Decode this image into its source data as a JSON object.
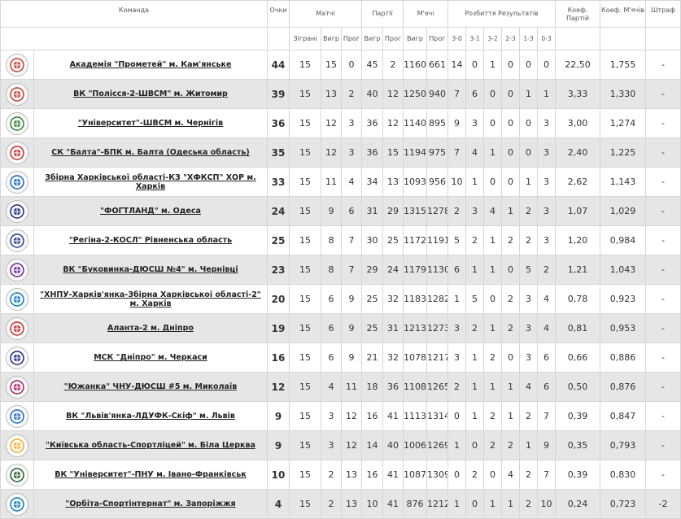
{
  "header": {
    "team": "Команда",
    "points": "Очки",
    "matches": "Матчі",
    "matches_sub": [
      "Зіграні",
      "Вигр",
      "Прог"
    ],
    "sets": "Партії",
    "sets_sub": [
      "Вигр",
      "Прог"
    ],
    "balls": "М'ячі",
    "balls_sub": [
      "Вигр",
      "Прог"
    ],
    "results": "Розбиття Результатів",
    "results_sub": [
      "3-0",
      "3-1",
      "3-2",
      "2-3",
      "1-3",
      "0-3"
    ],
    "coef_sets": "Коеф. Партій",
    "coef_balls": "Коеф. М'ячів",
    "penalty": "Штраф"
  },
  "rows": [
    {
      "team": "Академія \"Прометей\" м. Кам'янське",
      "logo": "team-logo-icon",
      "points": "44",
      "played": "15",
      "won": "15",
      "lost": "0",
      "sets_won": "45",
      "sets_lost": "2",
      "balls_won": "1160",
      "balls_lost": "661",
      "r30": "14",
      "r31": "0",
      "r32": "1",
      "r23": "0",
      "r13": "0",
      "r03": "0",
      "coef_sets": "22,50",
      "coef_balls": "1,755",
      "penalty": "-"
    },
    {
      "team": "ВК \"Полісся-2-ШВСМ\" м. Житомир",
      "logo": "team-logo-icon",
      "points": "39",
      "played": "15",
      "won": "13",
      "lost": "2",
      "sets_won": "40",
      "sets_lost": "12",
      "balls_won": "1250",
      "balls_lost": "940",
      "r30": "7",
      "r31": "6",
      "r32": "0",
      "r23": "0",
      "r13": "1",
      "r03": "1",
      "coef_sets": "3,33",
      "coef_balls": "1,330",
      "penalty": "-"
    },
    {
      "team": "\"Університет\"-ШВСМ м. Чернігів",
      "logo": "team-logo-icon",
      "points": "36",
      "played": "15",
      "won": "12",
      "lost": "3",
      "sets_won": "36",
      "sets_lost": "12",
      "balls_won": "1140",
      "balls_lost": "895",
      "r30": "9",
      "r31": "3",
      "r32": "0",
      "r23": "0",
      "r13": "0",
      "r03": "3",
      "coef_sets": "3,00",
      "coef_balls": "1,274",
      "penalty": "-"
    },
    {
      "team": "СК \"Балта\"-БПК м. Балта (Одеська область)",
      "logo": "team-logo-icon",
      "points": "35",
      "played": "15",
      "won": "12",
      "lost": "3",
      "sets_won": "36",
      "sets_lost": "15",
      "balls_won": "1194",
      "balls_lost": "975",
      "r30": "7",
      "r31": "4",
      "r32": "1",
      "r23": "0",
      "r13": "0",
      "r03": "3",
      "coef_sets": "2,40",
      "coef_balls": "1,225",
      "penalty": "-"
    },
    {
      "team": "Збірна Харківської області-КЗ \"ХФКСП\" ХОР м. Харків",
      "logo": "team-logo-icon",
      "points": "33",
      "played": "15",
      "won": "11",
      "lost": "4",
      "sets_won": "34",
      "sets_lost": "13",
      "balls_won": "1093",
      "balls_lost": "956",
      "r30": "10",
      "r31": "1",
      "r32": "0",
      "r23": "0",
      "r13": "1",
      "r03": "3",
      "coef_sets": "2,62",
      "coef_balls": "1,143",
      "penalty": "-"
    },
    {
      "team": "\"ФОГТЛАНД\" м. Одеса",
      "logo": "team-logo-icon",
      "points": "24",
      "played": "15",
      "won": "9",
      "lost": "6",
      "sets_won": "31",
      "sets_lost": "29",
      "balls_won": "1315",
      "balls_lost": "1278",
      "r30": "2",
      "r31": "3",
      "r32": "4",
      "r23": "1",
      "r13": "2",
      "r03": "3",
      "coef_sets": "1,07",
      "coef_balls": "1,029",
      "penalty": "-"
    },
    {
      "team": "\"Регіна-2-КОСЛ\" Рівненська область",
      "logo": "team-logo-icon",
      "points": "25",
      "played": "15",
      "won": "8",
      "lost": "7",
      "sets_won": "30",
      "sets_lost": "25",
      "balls_won": "1172",
      "balls_lost": "1191",
      "r30": "5",
      "r31": "2",
      "r32": "1",
      "r23": "2",
      "r13": "2",
      "r03": "3",
      "coef_sets": "1,20",
      "coef_balls": "0,984",
      "penalty": "-"
    },
    {
      "team": "ВК \"Буковинка-ДЮСШ №4\" м. Чернівці",
      "logo": "team-logo-icon",
      "points": "23",
      "played": "15",
      "won": "8",
      "lost": "7",
      "sets_won": "29",
      "sets_lost": "24",
      "balls_won": "1179",
      "balls_lost": "1130",
      "r30": "6",
      "r31": "1",
      "r32": "1",
      "r23": "0",
      "r13": "5",
      "r03": "2",
      "coef_sets": "1,21",
      "coef_balls": "1,043",
      "penalty": "-"
    },
    {
      "team": "\"ХНПУ-Харків'янка-Збірна Харківської області-2\" м. Харків",
      "logo": "team-logo-icon",
      "points": "20",
      "played": "15",
      "won": "6",
      "lost": "9",
      "sets_won": "25",
      "sets_lost": "32",
      "balls_won": "1183",
      "balls_lost": "1282",
      "r30": "1",
      "r31": "5",
      "r32": "0",
      "r23": "2",
      "r13": "3",
      "r03": "4",
      "coef_sets": "0,78",
      "coef_balls": "0,923",
      "penalty": "-"
    },
    {
      "team": "Аланта-2 м. Дніпро",
      "logo": "team-logo-icon",
      "points": "19",
      "played": "15",
      "won": "6",
      "lost": "9",
      "sets_won": "25",
      "sets_lost": "31",
      "balls_won": "1213",
      "balls_lost": "1273",
      "r30": "3",
      "r31": "2",
      "r32": "1",
      "r23": "2",
      "r13": "3",
      "r03": "4",
      "coef_sets": "0,81",
      "coef_balls": "0,953",
      "penalty": "-"
    },
    {
      "team": "МСК \"Дніпро\" м. Черкаси",
      "logo": "team-logo-icon",
      "points": "16",
      "played": "15",
      "won": "6",
      "lost": "9",
      "sets_won": "21",
      "sets_lost": "32",
      "balls_won": "1078",
      "balls_lost": "1217",
      "r30": "3",
      "r31": "1",
      "r32": "2",
      "r23": "0",
      "r13": "3",
      "r03": "6",
      "coef_sets": "0,66",
      "coef_balls": "0,886",
      "penalty": "-"
    },
    {
      "team": "\"Южанка\" ЧНУ-ДЮСШ #5 м. Миколаїв",
      "logo": "team-logo-icon",
      "points": "12",
      "played": "15",
      "won": "4",
      "lost": "11",
      "sets_won": "18",
      "sets_lost": "36",
      "balls_won": "1108",
      "balls_lost": "1265",
      "r30": "2",
      "r31": "1",
      "r32": "1",
      "r23": "1",
      "r13": "4",
      "r03": "6",
      "coef_sets": "0,50",
      "coef_balls": "0,876",
      "penalty": "-"
    },
    {
      "team": "ВК \"Львів'янка-ЛДУФК-Скіф\" м. Львів",
      "logo": "team-logo-icon",
      "points": "9",
      "played": "15",
      "won": "3",
      "lost": "12",
      "sets_won": "16",
      "sets_lost": "41",
      "balls_won": "1113",
      "balls_lost": "1314",
      "r30": "0",
      "r31": "1",
      "r32": "2",
      "r23": "1",
      "r13": "2",
      "r03": "7",
      "coef_sets": "0,39",
      "coef_balls": "0,847",
      "penalty": "-"
    },
    {
      "team": "\"Київська область-Спортліцей\" м. Біла Церква",
      "logo": "team-logo-icon",
      "points": "9",
      "played": "15",
      "won": "3",
      "lost": "12",
      "sets_won": "14",
      "sets_lost": "40",
      "balls_won": "1006",
      "balls_lost": "1269",
      "r30": "1",
      "r31": "0",
      "r32": "2",
      "r23": "2",
      "r13": "1",
      "r03": "9",
      "coef_sets": "0,35",
      "coef_balls": "0,793",
      "penalty": "-"
    },
    {
      "team": "ВК \"Університет\"-ПНУ м. Івано-Франківськ",
      "logo": "team-logo-icon",
      "points": "10",
      "played": "15",
      "won": "2",
      "lost": "13",
      "sets_won": "16",
      "sets_lost": "41",
      "balls_won": "1087",
      "balls_lost": "1309",
      "r30": "0",
      "r31": "2",
      "r32": "0",
      "r23": "4",
      "r13": "2",
      "r03": "7",
      "coef_sets": "0,39",
      "coef_balls": "0,830",
      "penalty": "-"
    },
    {
      "team": "\"Орбіта-Спортінтернат\" м. Запоріжжя",
      "logo": "team-logo-icon",
      "points": "4",
      "played": "15",
      "won": "2",
      "lost": "13",
      "sets_won": "10",
      "sets_lost": "41",
      "balls_won": "876",
      "balls_lost": "1212",
      "r30": "1",
      "r31": "0",
      "r32": "1",
      "r23": "1",
      "r13": "2",
      "r03": "10",
      "coef_sets": "0,24",
      "coef_balls": "0,723",
      "penalty": "-2"
    }
  ]
}
